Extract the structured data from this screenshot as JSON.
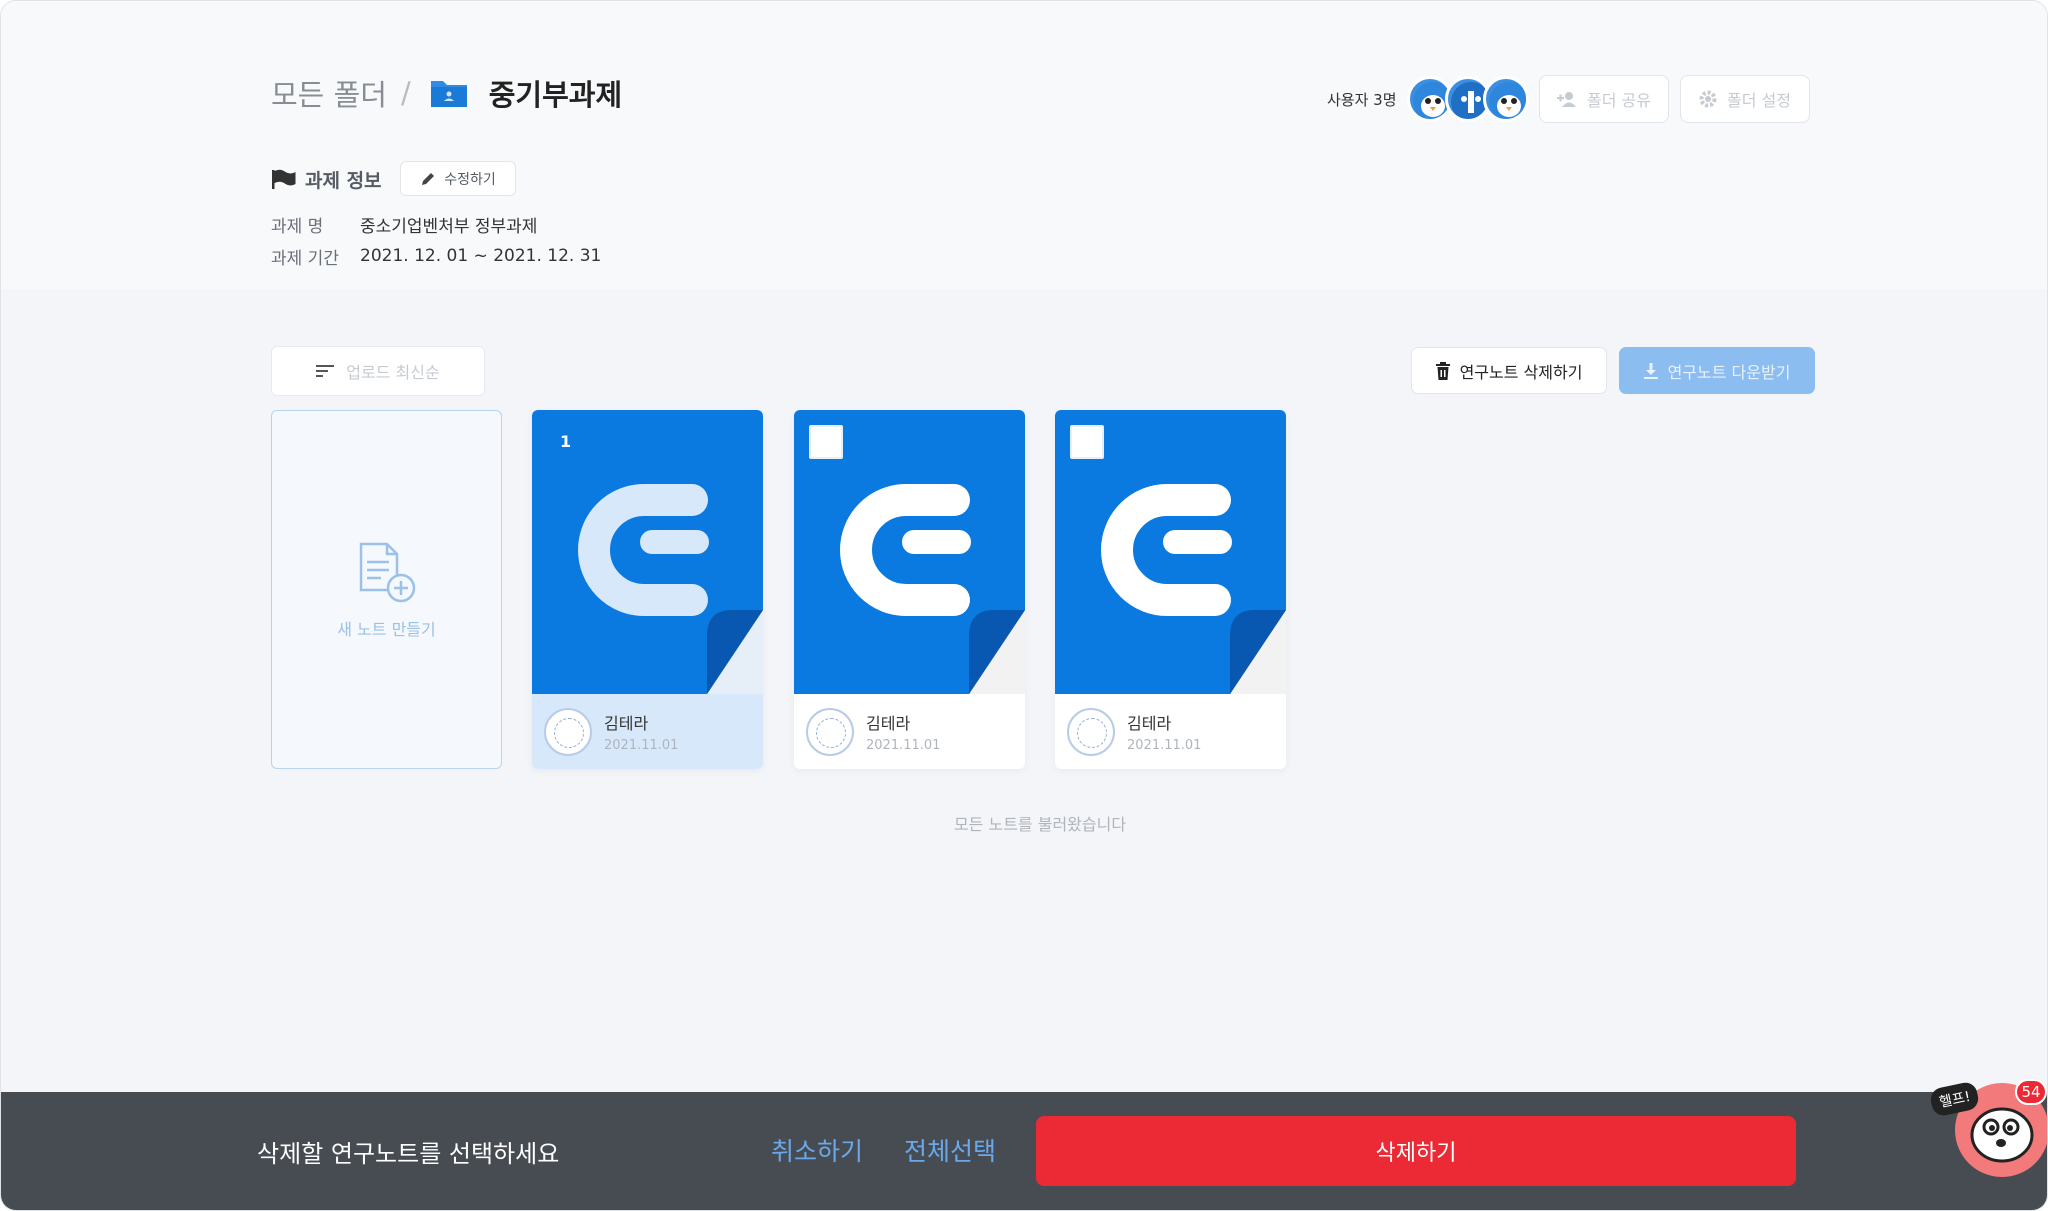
{
  "breadcrumb": {
    "root": "모든 폴더",
    "separator": "/",
    "current": "중기부과제"
  },
  "header": {
    "users_label": "사용자 3명",
    "share_label": "폴더 공유",
    "settings_label": "폴더 설정"
  },
  "project_info": {
    "title": "과제 정보",
    "edit_label": "수정하기",
    "rows": [
      {
        "label": "과제 명",
        "value": "중소기업벤처부 정부과제"
      },
      {
        "label": "과제 기간",
        "value": "2021. 12. 01 ~ 2021. 12. 31"
      }
    ]
  },
  "toolbar": {
    "sort_label": "업로드 최신순",
    "delete_notes_label": "연구노트 삭제하기",
    "download_label": "연구노트 다운받기"
  },
  "new_note": {
    "label": "새 노트 만들기"
  },
  "notes": [
    {
      "author": "김테라",
      "date": "2021.11.01",
      "selected_order": "1",
      "selected": true
    },
    {
      "author": "김테라",
      "date": "2021.11.01",
      "selected": false
    },
    {
      "author": "김테라",
      "date": "2021.11.01",
      "selected": false
    }
  ],
  "loaded_message": "모든 노트를 불러왔습니다",
  "bottom_bar": {
    "prompt": "삭제할 연구노트를 선택하세요",
    "cancel_label": "취소하기",
    "select_all_label": "전체선택",
    "delete_label": "삭제하기"
  },
  "help": {
    "label": "헬프!",
    "count": "54"
  },
  "colors": {
    "brand_blue": "#0a7ae0",
    "delete_red": "#ec2a35",
    "bottom_bar": "#474c53"
  }
}
